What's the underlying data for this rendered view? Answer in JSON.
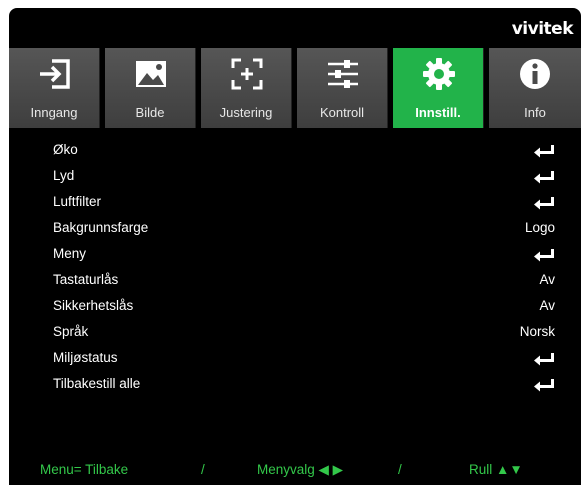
{
  "brand": "vivitek",
  "tabs": [
    {
      "label": "Inngang",
      "icon": "input-icon",
      "active": false
    },
    {
      "label": "Bilde",
      "icon": "image-icon",
      "active": false
    },
    {
      "label": "Justering",
      "icon": "adjust-icon",
      "active": false
    },
    {
      "label": "Kontroll",
      "icon": "sliders-icon",
      "active": false
    },
    {
      "label": "Innstill.",
      "icon": "gear-icon",
      "active": true
    },
    {
      "label": "Info",
      "icon": "info-icon",
      "active": false
    }
  ],
  "menu": [
    {
      "label": "Øko",
      "value": "",
      "enter": true
    },
    {
      "label": "Lyd",
      "value": "",
      "enter": true
    },
    {
      "label": "Luftfilter",
      "value": "",
      "enter": true
    },
    {
      "label": "Bakgrunnsfarge",
      "value": "Logo",
      "enter": false
    },
    {
      "label": "Meny",
      "value": "",
      "enter": true
    },
    {
      "label": "Tastaturlås",
      "value": "Av",
      "enter": false
    },
    {
      "label": "Sikkerhetslås",
      "value": "Av",
      "enter": false
    },
    {
      "label": "Språk",
      "value": "Norsk",
      "enter": false
    },
    {
      "label": "Miljøstatus",
      "value": "",
      "enter": true
    },
    {
      "label": "Tilbakestill alle",
      "value": "",
      "enter": true
    }
  ],
  "footer": {
    "back": "Menu= Tilbake",
    "sep1": "/",
    "select": "Menyvalg ◀ ▶",
    "sep2": "/",
    "scroll": "Rull ▲▼"
  },
  "colors": {
    "active_tab": "#22b34a",
    "footer_text": "#33c84a",
    "background": "#000000"
  }
}
